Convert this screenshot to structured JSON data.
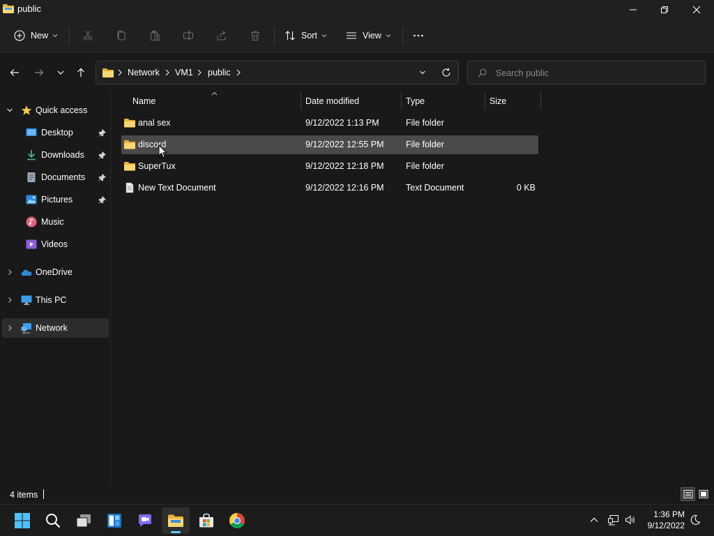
{
  "window": {
    "title": "public",
    "controls": [
      "minimize",
      "restore",
      "close"
    ]
  },
  "commandbar": {
    "new_label": "New",
    "sort_label": "Sort",
    "view_label": "View",
    "actions": [
      "cut-icon",
      "copy-icon",
      "paste-icon",
      "rename-icon",
      "share-icon",
      "delete-icon"
    ]
  },
  "address": {
    "crumbs": [
      "Network",
      "VM1",
      "public"
    ]
  },
  "search": {
    "placeholder": "Search public"
  },
  "sidebar": {
    "items": [
      {
        "label": "Quick access",
        "icon": "star-icon"
      },
      {
        "label": "Desktop",
        "icon": "desktop-icon",
        "pinned": true
      },
      {
        "label": "Downloads",
        "icon": "downloads-icon",
        "pinned": true
      },
      {
        "label": "Documents",
        "icon": "documents-icon",
        "pinned": true
      },
      {
        "label": "Pictures",
        "icon": "pictures-icon",
        "pinned": true
      },
      {
        "label": "Music",
        "icon": "music-icon"
      },
      {
        "label": "Videos",
        "icon": "videos-icon"
      },
      {
        "label": "OneDrive",
        "icon": "onedrive-icon"
      },
      {
        "label": "This PC",
        "icon": "pc-icon"
      },
      {
        "label": "Network",
        "icon": "network-icon",
        "selected": true
      }
    ]
  },
  "filelist": {
    "columns": {
      "name": "Name",
      "date": "Date modified",
      "type": "Type",
      "size": "Size"
    },
    "rows": [
      {
        "name": "anal sex",
        "date": "9/12/2022 1:13 PM",
        "type": "File folder",
        "size": "",
        "icon": "folder-icon"
      },
      {
        "name": "discord",
        "date": "9/12/2022 12:55 PM",
        "type": "File folder",
        "size": "",
        "icon": "folder-icon",
        "selected": true
      },
      {
        "name": "SuperTux",
        "date": "9/12/2022 12:18 PM",
        "type": "File folder",
        "size": "",
        "icon": "folder-icon"
      },
      {
        "name": "New Text Document",
        "date": "9/12/2022 12:16 PM",
        "type": "Text Document",
        "size": "0 KB",
        "icon": "text-file-icon"
      }
    ]
  },
  "statusbar": {
    "count": "4 items"
  },
  "taskbar": {
    "apps": [
      "start-icon",
      "search-icon",
      "task-view-icon",
      "widgets-icon",
      "teams-chat-icon",
      "file-explorer-icon",
      "store-icon",
      "chrome-icon"
    ],
    "time": "1:36 PM",
    "date": "9/12/2022"
  },
  "colors": {
    "background": "#191919",
    "chrome": "#202020",
    "selection": "#4a4a4a",
    "folder": "#f2c94c",
    "accent": "#60cdff"
  }
}
